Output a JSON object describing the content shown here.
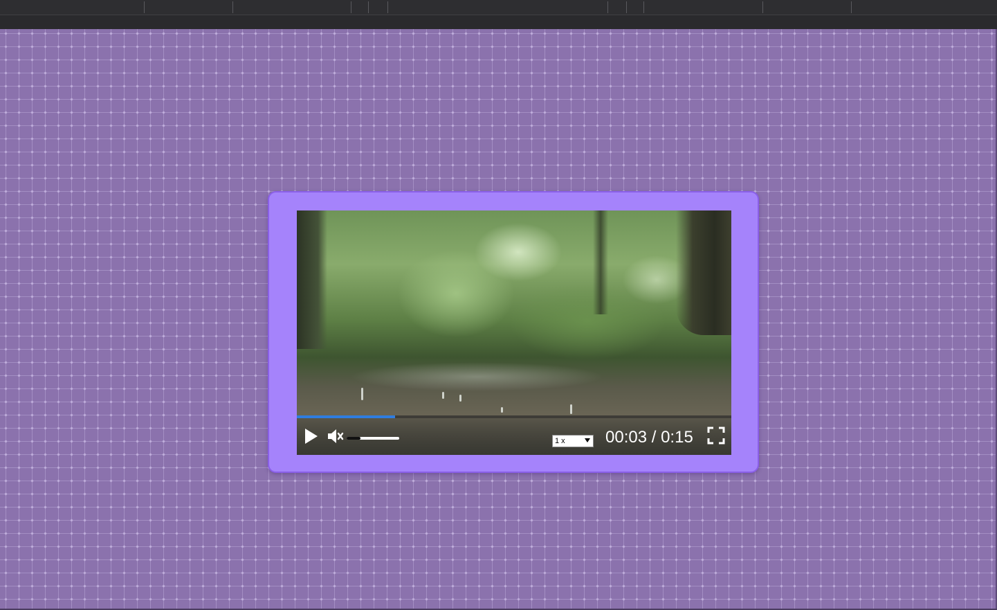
{
  "player": {
    "current_time": "00:03",
    "separator": "/",
    "duration": "0:15",
    "progress_fraction": 0.226,
    "volume_fraction": 0.26,
    "speed": {
      "selected": "1 x"
    },
    "icons": {
      "play": "play-icon",
      "mute": "volume-muted-icon",
      "fullscreen": "fullscreen-icon",
      "dropdown": "chevron-down-icon"
    }
  },
  "colors": {
    "background": "#8b72ad",
    "card": "#a583fb",
    "card_border": "#8a5fe8",
    "progress": "#2f7de0"
  }
}
